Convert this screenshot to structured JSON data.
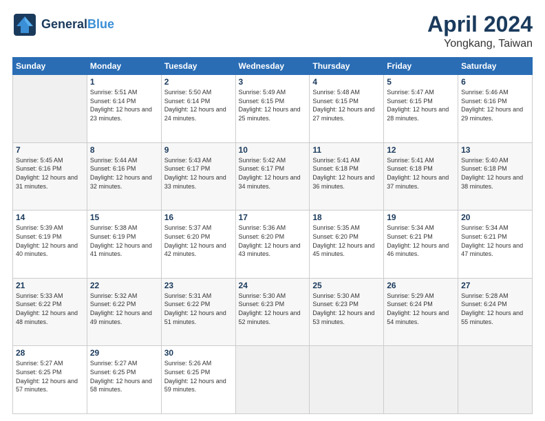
{
  "header": {
    "logo_line1": "General",
    "logo_line2": "Blue",
    "title": "April 2024",
    "subtitle": "Yongkang, Taiwan"
  },
  "days_of_week": [
    "Sunday",
    "Monday",
    "Tuesday",
    "Wednesday",
    "Thursday",
    "Friday",
    "Saturday"
  ],
  "weeks": [
    [
      {
        "day": "",
        "info": ""
      },
      {
        "day": "1",
        "info": "Sunrise: 5:51 AM\nSunset: 6:14 PM\nDaylight: 12 hours\nand 23 minutes."
      },
      {
        "day": "2",
        "info": "Sunrise: 5:50 AM\nSunset: 6:14 PM\nDaylight: 12 hours\nand 24 minutes."
      },
      {
        "day": "3",
        "info": "Sunrise: 5:49 AM\nSunset: 6:15 PM\nDaylight: 12 hours\nand 25 minutes."
      },
      {
        "day": "4",
        "info": "Sunrise: 5:48 AM\nSunset: 6:15 PM\nDaylight: 12 hours\nand 27 minutes."
      },
      {
        "day": "5",
        "info": "Sunrise: 5:47 AM\nSunset: 6:15 PM\nDaylight: 12 hours\nand 28 minutes."
      },
      {
        "day": "6",
        "info": "Sunrise: 5:46 AM\nSunset: 6:16 PM\nDaylight: 12 hours\nand 29 minutes."
      }
    ],
    [
      {
        "day": "7",
        "info": "Sunrise: 5:45 AM\nSunset: 6:16 PM\nDaylight: 12 hours\nand 31 minutes."
      },
      {
        "day": "8",
        "info": "Sunrise: 5:44 AM\nSunset: 6:16 PM\nDaylight: 12 hours\nand 32 minutes."
      },
      {
        "day": "9",
        "info": "Sunrise: 5:43 AM\nSunset: 6:17 PM\nDaylight: 12 hours\nand 33 minutes."
      },
      {
        "day": "10",
        "info": "Sunrise: 5:42 AM\nSunset: 6:17 PM\nDaylight: 12 hours\nand 34 minutes."
      },
      {
        "day": "11",
        "info": "Sunrise: 5:41 AM\nSunset: 6:18 PM\nDaylight: 12 hours\nand 36 minutes."
      },
      {
        "day": "12",
        "info": "Sunrise: 5:41 AM\nSunset: 6:18 PM\nDaylight: 12 hours\nand 37 minutes."
      },
      {
        "day": "13",
        "info": "Sunrise: 5:40 AM\nSunset: 6:18 PM\nDaylight: 12 hours\nand 38 minutes."
      }
    ],
    [
      {
        "day": "14",
        "info": "Sunrise: 5:39 AM\nSunset: 6:19 PM\nDaylight: 12 hours\nand 40 minutes."
      },
      {
        "day": "15",
        "info": "Sunrise: 5:38 AM\nSunset: 6:19 PM\nDaylight: 12 hours\nand 41 minutes."
      },
      {
        "day": "16",
        "info": "Sunrise: 5:37 AM\nSunset: 6:20 PM\nDaylight: 12 hours\nand 42 minutes."
      },
      {
        "day": "17",
        "info": "Sunrise: 5:36 AM\nSunset: 6:20 PM\nDaylight: 12 hours\nand 43 minutes."
      },
      {
        "day": "18",
        "info": "Sunrise: 5:35 AM\nSunset: 6:20 PM\nDaylight: 12 hours\nand 45 minutes."
      },
      {
        "day": "19",
        "info": "Sunrise: 5:34 AM\nSunset: 6:21 PM\nDaylight: 12 hours\nand 46 minutes."
      },
      {
        "day": "20",
        "info": "Sunrise: 5:34 AM\nSunset: 6:21 PM\nDaylight: 12 hours\nand 47 minutes."
      }
    ],
    [
      {
        "day": "21",
        "info": "Sunrise: 5:33 AM\nSunset: 6:22 PM\nDaylight: 12 hours\nand 48 minutes."
      },
      {
        "day": "22",
        "info": "Sunrise: 5:32 AM\nSunset: 6:22 PM\nDaylight: 12 hours\nand 49 minutes."
      },
      {
        "day": "23",
        "info": "Sunrise: 5:31 AM\nSunset: 6:22 PM\nDaylight: 12 hours\nand 51 minutes."
      },
      {
        "day": "24",
        "info": "Sunrise: 5:30 AM\nSunset: 6:23 PM\nDaylight: 12 hours\nand 52 minutes."
      },
      {
        "day": "25",
        "info": "Sunrise: 5:30 AM\nSunset: 6:23 PM\nDaylight: 12 hours\nand 53 minutes."
      },
      {
        "day": "26",
        "info": "Sunrise: 5:29 AM\nSunset: 6:24 PM\nDaylight: 12 hours\nand 54 minutes."
      },
      {
        "day": "27",
        "info": "Sunrise: 5:28 AM\nSunset: 6:24 PM\nDaylight: 12 hours\nand 55 minutes."
      }
    ],
    [
      {
        "day": "28",
        "info": "Sunrise: 5:27 AM\nSunset: 6:25 PM\nDaylight: 12 hours\nand 57 minutes."
      },
      {
        "day": "29",
        "info": "Sunrise: 5:27 AM\nSunset: 6:25 PM\nDaylight: 12 hours\nand 58 minutes."
      },
      {
        "day": "30",
        "info": "Sunrise: 5:26 AM\nSunset: 6:25 PM\nDaylight: 12 hours\nand 59 minutes."
      },
      {
        "day": "",
        "info": ""
      },
      {
        "day": "",
        "info": ""
      },
      {
        "day": "",
        "info": ""
      },
      {
        "day": "",
        "info": ""
      }
    ]
  ]
}
